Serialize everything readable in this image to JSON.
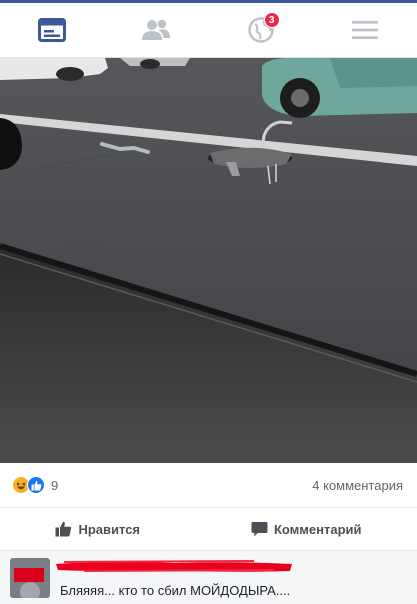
{
  "nav": {
    "items": [
      {
        "name": "news-feed",
        "active": true
      },
      {
        "name": "friend-requests",
        "active": false
      },
      {
        "name": "notifications",
        "active": false,
        "badge": "3"
      },
      {
        "name": "menu",
        "active": false
      }
    ],
    "accent": "#3b5998",
    "badge_color": "#f02849"
  },
  "post": {
    "reactions": [
      "haha",
      "like"
    ],
    "reaction_count": "9",
    "comments_count": "4 комментария"
  },
  "actions": {
    "like_label": "Нравится",
    "comment_label": "Комментарий"
  },
  "comment": {
    "author_redacted": true,
    "text": "Бляяяя... кто то сбил МОЙДОДЫРА...."
  }
}
